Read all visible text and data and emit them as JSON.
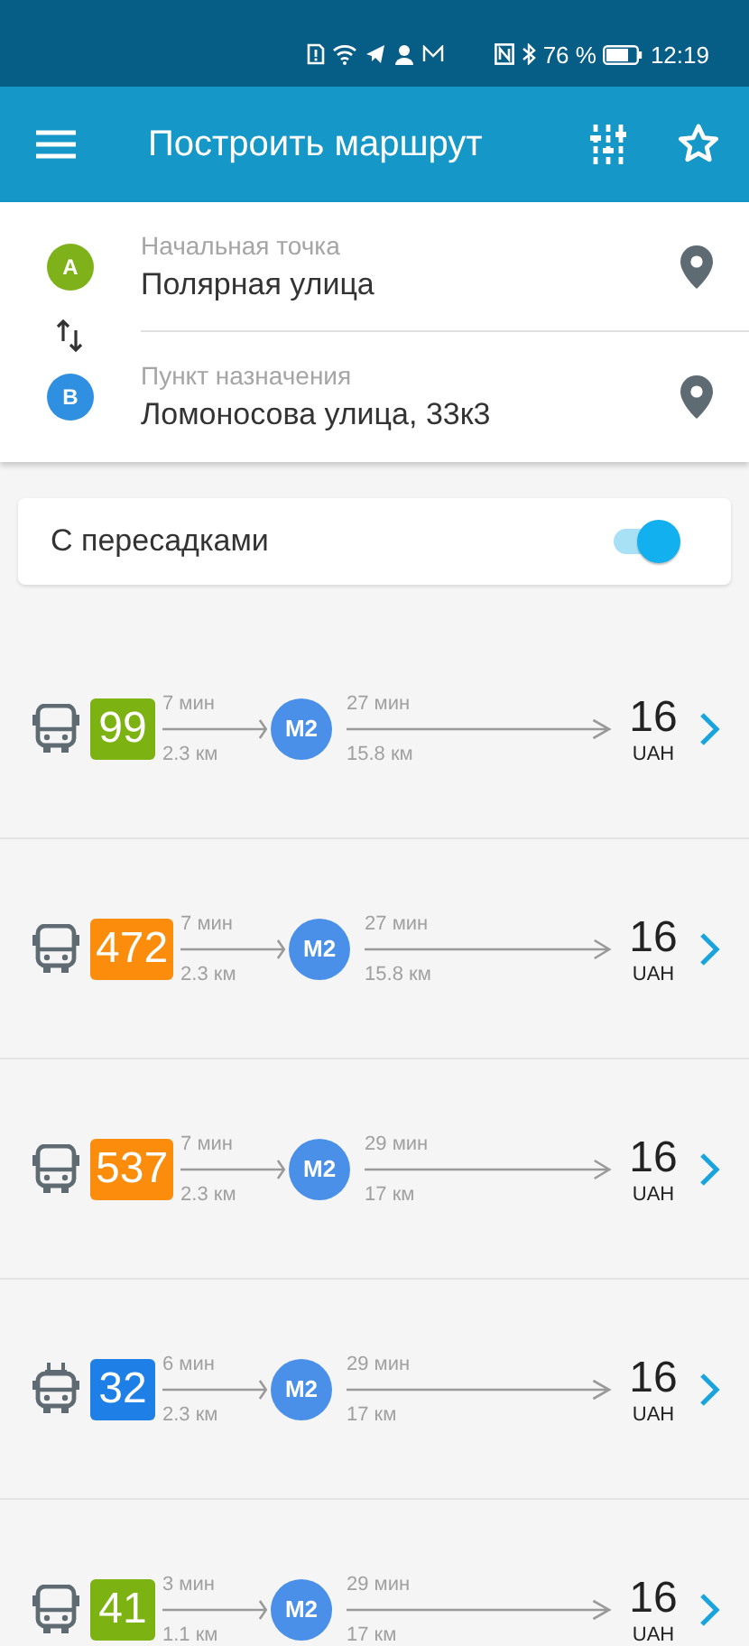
{
  "status_bar": {
    "battery": "76 %",
    "time": "12:19"
  },
  "app_bar": {
    "title": "Построить маршрут"
  },
  "points": [
    {
      "marker": "A",
      "color": "#7fb21a",
      "label": "Начальная точка",
      "value": "Полярная улица"
    },
    {
      "marker": "B",
      "color": "#2f8fe0",
      "label": "Пункт назначения",
      "value": "Ломоносова улица, 33к3"
    }
  ],
  "transfers": {
    "label": "С пересадками",
    "on": true
  },
  "routes": [
    {
      "kind": "bus",
      "number": "99",
      "color": "#7cb313",
      "leg_time": "7 мин",
      "leg_distance": "2.3 км",
      "metro": "M2",
      "metro_time": "27 мин",
      "metro_distance": "15.8 км",
      "price": "16",
      "currency": "UAH"
    },
    {
      "kind": "bus",
      "number": "472",
      "color": "#fb8c0c",
      "leg_time": "7 мин",
      "leg_distance": "2.3 км",
      "metro": "M2",
      "metro_time": "27 мин",
      "metro_distance": "15.8 км",
      "price": "16",
      "currency": "UAH"
    },
    {
      "kind": "bus",
      "number": "537",
      "color": "#fb8c0c",
      "leg_time": "7 мин",
      "leg_distance": "2.3 км",
      "metro": "M2",
      "metro_time": "29 мин",
      "metro_distance": "17 км",
      "price": "16",
      "currency": "UAH"
    },
    {
      "kind": "trolleybus",
      "number": "32",
      "color": "#1e7fe6",
      "leg_time": "6 мин",
      "leg_distance": "2.3 км",
      "metro": "M2",
      "metro_time": "29 мин",
      "metro_distance": "17 км",
      "price": "16",
      "currency": "UAH"
    },
    {
      "kind": "bus",
      "number": "41",
      "color": "#7cb313",
      "leg_time": "3 мин",
      "leg_distance": "1.1 км",
      "metro": "M2",
      "metro_time": "29 мин",
      "metro_distance": "17 км",
      "price": "16",
      "currency": "UAH"
    }
  ]
}
